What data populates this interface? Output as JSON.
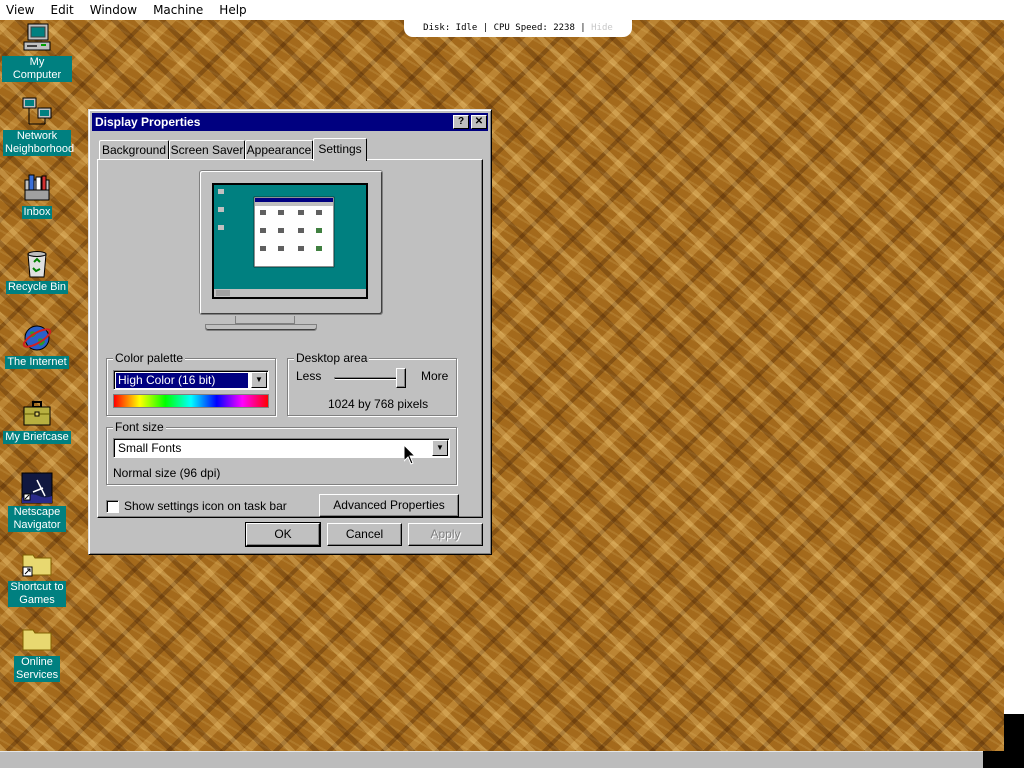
{
  "host": {
    "menu": [
      "View",
      "Edit",
      "Window",
      "Machine",
      "Help"
    ],
    "status": "Disk: Idle | CPU Speed: 2238 | ",
    "status_hide": "Hide"
  },
  "desktop_icons": [
    {
      "label": "My Computer",
      "icon": "computer-icon"
    },
    {
      "label": "Network Neighborhood",
      "icon": "network-icon"
    },
    {
      "label": "Inbox",
      "icon": "inbox-icon"
    },
    {
      "label": "Recycle Bin",
      "icon": "recycle-bin-icon"
    },
    {
      "label": "The Internet",
      "icon": "internet-globe-icon"
    },
    {
      "label": "My Briefcase",
      "icon": "briefcase-icon"
    },
    {
      "label": "Netscape Navigator",
      "icon": "netscape-icon"
    },
    {
      "label": "Shortcut to Games",
      "icon": "folder-shortcut-icon"
    },
    {
      "label": "Online Services",
      "icon": "folder-icon"
    }
  ],
  "dialog": {
    "title": "Display Properties",
    "help_button": "?",
    "close_button": "✕",
    "tabs": [
      "Background",
      "Screen Saver",
      "Appearance",
      "Settings"
    ],
    "active_tab": "Settings",
    "color_palette": {
      "label": "Color palette",
      "value": "High Color (16 bit)"
    },
    "desktop_area": {
      "label": "Desktop area",
      "less": "Less",
      "more": "More",
      "value": "1024 by 768 pixels",
      "slider_level": 1.0
    },
    "font_size": {
      "label": "Font size",
      "value": "Small Fonts",
      "note": "Normal size (96 dpi)"
    },
    "show_icon_checkbox": {
      "label": "Show settings icon on task bar",
      "checked": false
    },
    "advanced_button": "Advanced Properties",
    "ok": "OK",
    "cancel": "Cancel",
    "apply": "Apply"
  },
  "colors": {
    "desktop_teal": "#008080",
    "titlebar": "#000080",
    "window_face": "#c0c0c0",
    "wallpaper": "#a46a1c"
  }
}
